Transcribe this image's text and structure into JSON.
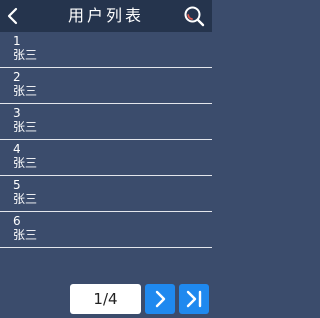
{
  "header": {
    "title": "用户列表",
    "back_icon": "chevron-left-icon",
    "search_icon": "search-icon"
  },
  "list": {
    "items": [
      {
        "id": "1",
        "name": "张三"
      },
      {
        "id": "2",
        "name": "张三"
      },
      {
        "id": "3",
        "name": "张三"
      },
      {
        "id": "4",
        "name": "张三"
      },
      {
        "id": "5",
        "name": "张三"
      },
      {
        "id": "6",
        "name": "张三"
      }
    ]
  },
  "pagination": {
    "page_indicator": "1/4",
    "next_icon": "chevron-right-icon",
    "last_icon": "skip-to-last-icon"
  },
  "colors": {
    "background": "#3b4c6c",
    "header": "#25344d",
    "accent": "#1f89ef",
    "divider": "#e3e6ec"
  }
}
